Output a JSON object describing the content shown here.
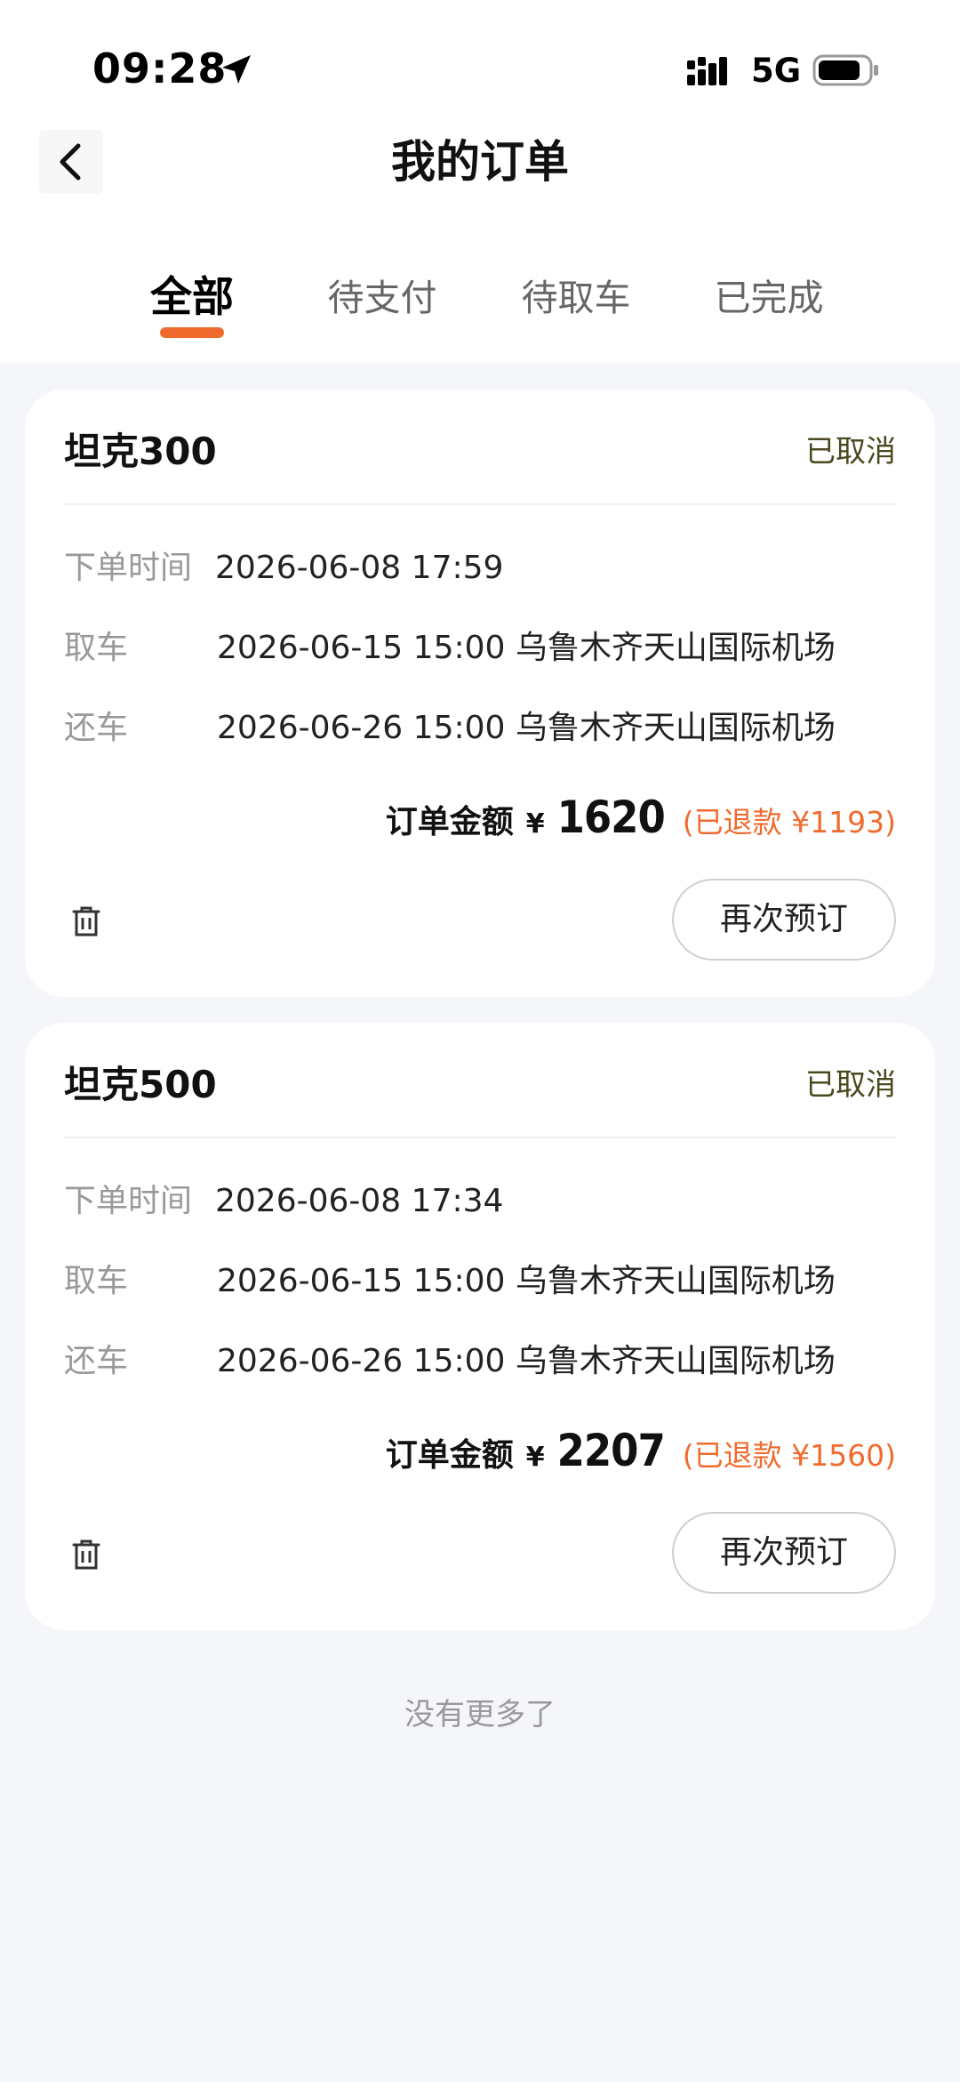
{
  "status_bar": {
    "time": "09:28",
    "network": "5G",
    "icons": [
      "location-arrow-icon",
      "signal-icon",
      "battery-icon"
    ]
  },
  "nav": {
    "title": "我的订单",
    "back_icon": "chevron-left-icon"
  },
  "tabs": [
    {
      "label": "全部",
      "active": true
    },
    {
      "label": "待支付",
      "active": false
    },
    {
      "label": "待取车",
      "active": false
    },
    {
      "label": "已完成",
      "active": false
    }
  ],
  "labels": {
    "order_time": "下单时间",
    "pickup": "取车",
    "return": "还车",
    "amount": "订单金额",
    "currency": "¥",
    "rebook": "再次预订"
  },
  "orders": [
    {
      "car": "坦克300",
      "status": "已取消",
      "order_time": "2026-06-08 17:59",
      "pickup": "2026-06-15 15:00 乌鲁木齐天山国际机场",
      "return": "2026-06-26 15:00 乌鲁木齐天山国际机场",
      "amount": "1620",
      "refund": "(已退款 ¥1193)"
    },
    {
      "car": "坦克500",
      "status": "已取消",
      "order_time": "2026-06-08 17:34",
      "pickup": "2026-06-15 15:00 乌鲁木齐天山国际机场",
      "return": "2026-06-26 15:00 乌鲁木齐天山国际机场",
      "amount": "2207",
      "refund": "(已退款 ¥1560)"
    }
  ],
  "footer": {
    "no_more": "没有更多了"
  },
  "colors": {
    "accent": "#f06b2e",
    "status_cancelled": "#4a4a1e",
    "background": "#f4f6fa"
  }
}
